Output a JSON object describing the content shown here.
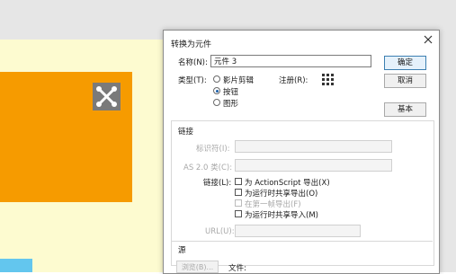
{
  "dialog": {
    "title": "转换为元件",
    "name_label": "名称(N):",
    "name_value": "元件 3",
    "type_label": "类型(T):",
    "type_options": [
      "影片剪辑",
      "按钮",
      "图形"
    ],
    "type_selected": "按钮",
    "registration_label": "注册(R):",
    "buttons": {
      "ok": "确定",
      "cancel": "取消",
      "basic": "基本"
    },
    "linkage_section": "链接",
    "identifier_label": "标识符(I):",
    "as2_class_label": "AS 2.0 类(C):",
    "linkage_label": "链接(L):",
    "linkage_options": [
      "为 ActionScript 导出(X)",
      "为运行时共享导出(O)",
      "在第一帧导出(F)",
      "为运行时共享导入(M)"
    ],
    "url_label": "URL(U):",
    "source_section": "源",
    "browse_button": "浏览(B)...",
    "file_label": "文件:"
  },
  "colors": {
    "stage_yellow": "#fdfbd0",
    "orange_box": "#f69b00",
    "accent_blue": "#1a5ea8"
  }
}
